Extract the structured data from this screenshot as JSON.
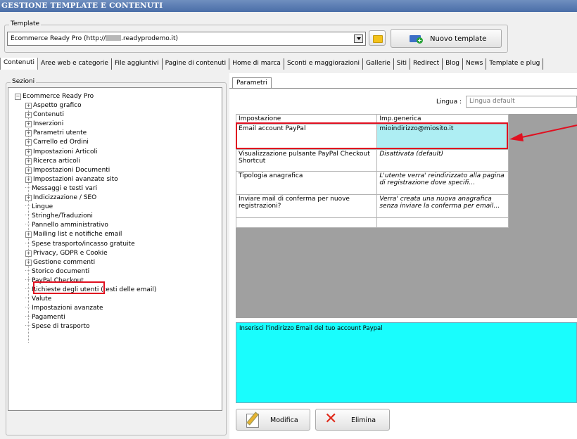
{
  "window": {
    "title": "GESTIONE TEMPLATE E CONTENUTI"
  },
  "template": {
    "group_label": "Template",
    "selected_prefix": "Ecommerce Ready Pro (http://",
    "selected_suffix": ".readyprodemo.it)",
    "new_template_label": "Nuovo template"
  },
  "tabs": [
    "Contenuti",
    "Aree web e categorie",
    "File aggiuntivi",
    "Pagine di contenuti",
    "Home di marca",
    "Sconti e maggiorazioni",
    "Gallerie",
    "Siti",
    "Redirect",
    "Blog",
    "News",
    "Template e plug"
  ],
  "sections": {
    "group_label": "Sezioni",
    "root": "Ecommerce Ready Pro",
    "items": [
      {
        "label": "Aspetto grafico",
        "expandable": true
      },
      {
        "label": "Contenuti",
        "expandable": true
      },
      {
        "label": "Inserzioni",
        "expandable": true
      },
      {
        "label": "Parametri utente",
        "expandable": true
      },
      {
        "label": "Carrello ed Ordini",
        "expandable": true
      },
      {
        "label": "Impostazioni Articoli",
        "expandable": true
      },
      {
        "label": "Ricerca articoli",
        "expandable": true
      },
      {
        "label": "Impostazioni Documenti",
        "expandable": true
      },
      {
        "label": "Impostazioni avanzate sito",
        "expandable": true
      },
      {
        "label": "Messaggi e testi vari",
        "expandable": false
      },
      {
        "label": "Indicizzazione / SEO",
        "expandable": true
      },
      {
        "label": "Lingue",
        "expandable": false
      },
      {
        "label": "Stringhe/Traduzioni",
        "expandable": false
      },
      {
        "label": "Pannello amministrativo",
        "expandable": false
      },
      {
        "label": "Mailing list e notifiche email",
        "expandable": true
      },
      {
        "label": "Spese trasporto/incasso gratuite",
        "expandable": false
      },
      {
        "label": "Privacy, GDPR e Cookie",
        "expandable": true
      },
      {
        "label": "Gestione commenti",
        "expandable": true
      },
      {
        "label": "Storico documenti",
        "expandable": false
      },
      {
        "label": "PayPal Checkout",
        "expandable": false,
        "selected": true
      },
      {
        "label": "Richieste degli utenti (testi delle email)",
        "expandable": false
      },
      {
        "label": "Valute",
        "expandable": false
      },
      {
        "label": "Impostazioni avanzate",
        "expandable": false
      },
      {
        "label": "Pagamenti",
        "expandable": false
      },
      {
        "label": "Spese di trasporto",
        "expandable": false
      }
    ]
  },
  "params": {
    "tab_label": "Parametri",
    "language_label": "Lingua :",
    "language_value": "Lingua default",
    "headers": [
      "Impostazione",
      "Imp.generica"
    ],
    "rows": [
      {
        "setting": "Email account PayPal",
        "value": "mioindirizzo@miosito.it",
        "italic": false
      },
      {
        "setting": "Visualizzazione pulsante PayPal Checkout Shortcut",
        "value": "Disattivata (default)",
        "italic": true
      },
      {
        "setting": "Tipologia anagrafica",
        "value": "L'utente verra' reindirizzato alla pagina di registrazione dove specifi…",
        "italic": true
      },
      {
        "setting": "Inviare mail di conferma per nuove registrazioni?",
        "value": "Verra' creata una nuova anagrafica senza inviare la conferma per email…",
        "italic": true
      },
      {
        "setting": "",
        "value": "",
        "italic": false
      }
    ],
    "description": "Inserisci l'indirizzo Email del tuo account Paypal",
    "edit_label": "Modifica",
    "delete_label": "Elimina"
  },
  "colors": {
    "highlight": "#e01020",
    "selected_cell": "#aeeef3",
    "description_bg": "#19fdfd"
  }
}
